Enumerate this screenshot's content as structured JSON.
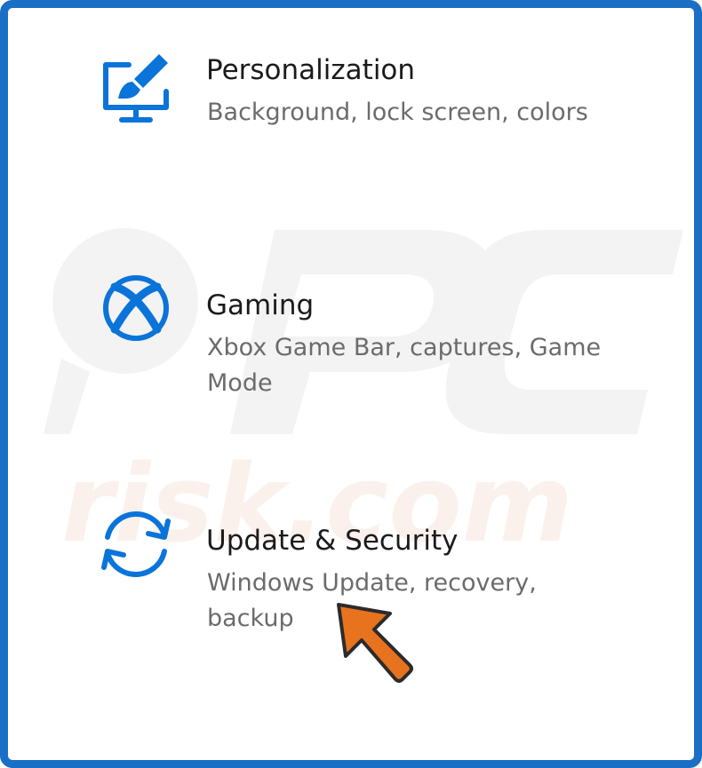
{
  "colors": {
    "accent": "#0a74d9",
    "border": "#1a6fc4",
    "title_text": "#1b1b1b",
    "desc_text": "#6b6b6b",
    "pointer_arrow": "#e8731e"
  },
  "settings": {
    "items": [
      {
        "icon": "personalization-icon",
        "title": "Personalization",
        "description": "Background, lock screen, colors"
      },
      {
        "icon": "xbox-icon",
        "title": "Gaming",
        "description": "Xbox Game Bar, captures, Game Mode"
      },
      {
        "icon": "update-sync-icon",
        "title": "Update & Security",
        "description": "Windows Update, recovery, backup"
      }
    ]
  },
  "watermark": {
    "logo_name": "pcrisk-watermark",
    "text": "risk.com"
  }
}
